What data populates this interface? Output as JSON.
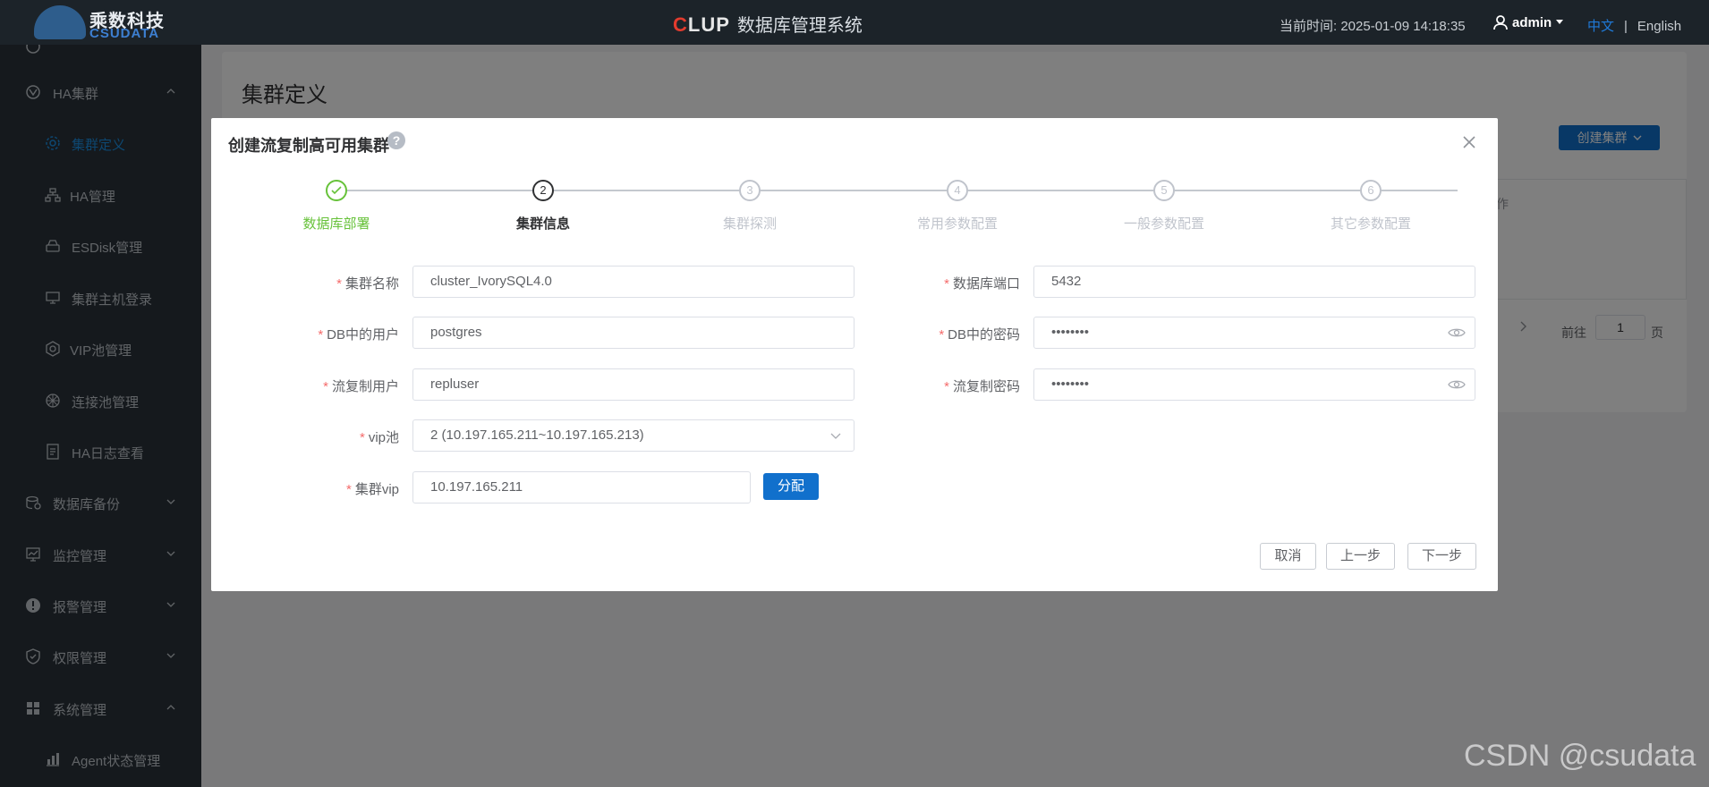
{
  "topbar": {
    "logo_cn": "乘数科技",
    "logo_en": "CSUDATA",
    "brand_c": "C",
    "brand_rest": "LUP",
    "app_title": "数据库管理系统",
    "time_label": "当前时间:",
    "time_value": "2025-01-09 14:18:35",
    "user": "admin",
    "lang_cn": "中文",
    "lang_sep": "|",
    "lang_en": "English"
  },
  "sidebar": {
    "items": [
      {
        "label": "HA集群",
        "icon": "cluster-icon",
        "expanded": true
      },
      {
        "label": "集群定义",
        "icon": "gear-icon",
        "active": true
      },
      {
        "label": "HA管理",
        "icon": "sitemap-icon"
      },
      {
        "label": "ESDisk管理",
        "icon": "disk-icon"
      },
      {
        "label": "集群主机登录",
        "icon": "monitor-icon"
      },
      {
        "label": "VIP池管理",
        "icon": "hexagon-gear-icon"
      },
      {
        "label": "连接池管理",
        "icon": "pool-icon"
      },
      {
        "label": "HA日志查看",
        "icon": "log-icon"
      },
      {
        "label": "数据库备份",
        "icon": "backup-icon"
      },
      {
        "label": "监控管理",
        "icon": "monitor-chart-icon"
      },
      {
        "label": "报警管理",
        "icon": "alert-icon"
      },
      {
        "label": "权限管理",
        "icon": "shield-icon"
      },
      {
        "label": "系统管理",
        "icon": "grid-icon",
        "expanded": true
      },
      {
        "label": "Agent状态管理",
        "icon": "bar-chart-icon"
      }
    ]
  },
  "page": {
    "title": "集群定义",
    "create_button": "创建集群",
    "table_header_partial": "作",
    "pagination": {
      "goto_label": "前往",
      "page_value": "1",
      "page_suffix": "页"
    }
  },
  "dialog": {
    "title": "创建流复制高可用集群",
    "help": "?",
    "steps": [
      {
        "index": "1",
        "label": "数据库部署",
        "status": "done"
      },
      {
        "index": "2",
        "label": "集群信息",
        "status": "process"
      },
      {
        "index": "3",
        "label": "集群探测",
        "status": "wait"
      },
      {
        "index": "4",
        "label": "常用参数配置",
        "status": "wait"
      },
      {
        "index": "5",
        "label": "一般参数配置",
        "status": "wait"
      },
      {
        "index": "6",
        "label": "其它参数配置",
        "status": "wait"
      }
    ],
    "form": {
      "cluster_name": {
        "label": "集群名称",
        "value": "cluster_IvorySQL4.0"
      },
      "db_port": {
        "label": "数据库端口",
        "value": "5432"
      },
      "db_user": {
        "label": "DB中的用户",
        "value": "postgres"
      },
      "db_password": {
        "label": "DB中的密码",
        "value": "••••••••"
      },
      "repl_user": {
        "label": "流复制用户",
        "value": "repluser"
      },
      "repl_password": {
        "label": "流复制密码",
        "value": "••••••••"
      },
      "vip_pool": {
        "label": "vip池",
        "value": "2 (10.197.165.211~10.197.165.213)"
      },
      "cluster_vip": {
        "label": "集群vip",
        "value": "10.197.165.211"
      },
      "required_mark": "*"
    },
    "allocate_button": "分配",
    "cancel_button": "取消",
    "prev_button": "上一步",
    "next_button": "下一步"
  },
  "watermark": "CSDN @csudata",
  "colors": {
    "primary": "#1170cc",
    "success": "#67c23a",
    "required": "#f56c6c",
    "sidebar_bg": "#2a323a",
    "topbar_bg": "#1c2329"
  }
}
